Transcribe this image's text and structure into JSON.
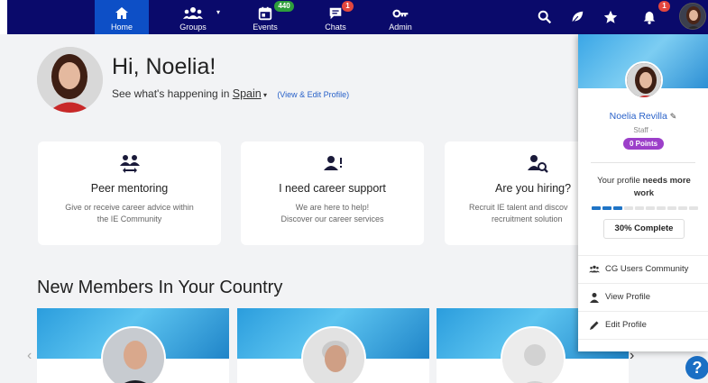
{
  "nav": {
    "items": [
      {
        "label": "Home",
        "icon": "home-icon"
      },
      {
        "label": "Groups",
        "icon": "groups-icon"
      },
      {
        "label": "Events",
        "icon": "calendar-icon",
        "badge": "440"
      },
      {
        "label": "Chats",
        "icon": "chat-icon",
        "badge": "1"
      },
      {
        "label": "Admin",
        "icon": "key-icon"
      }
    ],
    "notifications_badge": "1",
    "right_icons": [
      "search-icon",
      "leaf-icon",
      "star-icon",
      "bell-icon"
    ]
  },
  "greeting": {
    "title": "Hi, Noelia!",
    "subtitle_prefix": "See what's happening in",
    "country": "Spain",
    "edit_link": "(View & Edit Profile)"
  },
  "cards": [
    {
      "title": "Peer mentoring",
      "description_line1": "Give or receive career advice within",
      "description_line2": "the IE Community",
      "icon": "peer-mentoring-icon"
    },
    {
      "title": "I need career support",
      "description_line1": "We are here to help!",
      "description_line2": "Discover our career services",
      "icon": "career-support-icon"
    },
    {
      "title": "Are you hiring?",
      "description_line1": "Recruit IE talent and discov",
      "description_line2": "recruitment solution",
      "icon": "hiring-icon"
    }
  ],
  "section": {
    "title": "New Members In Your Country"
  },
  "profile_panel": {
    "name": "Noelia Revilla",
    "role": "Staff ·",
    "points": "0 Points",
    "status_prefix": "Your profile",
    "status_bold": "needs more work",
    "progress_percent": 30,
    "complete_label": "30% Complete",
    "menu": [
      {
        "label": "CG Users Community",
        "icon": "community-icon"
      },
      {
        "label": "View Profile",
        "icon": "user-icon"
      },
      {
        "label": "Edit Profile",
        "icon": "pencil-icon"
      }
    ]
  },
  "help_label": "?",
  "colors": {
    "nav_bg": "#0a0a6b",
    "nav_active": "#0d4fc6",
    "link": "#2a62c9",
    "points_badge": "#9c3fc9",
    "progress": "#1f74c6"
  }
}
